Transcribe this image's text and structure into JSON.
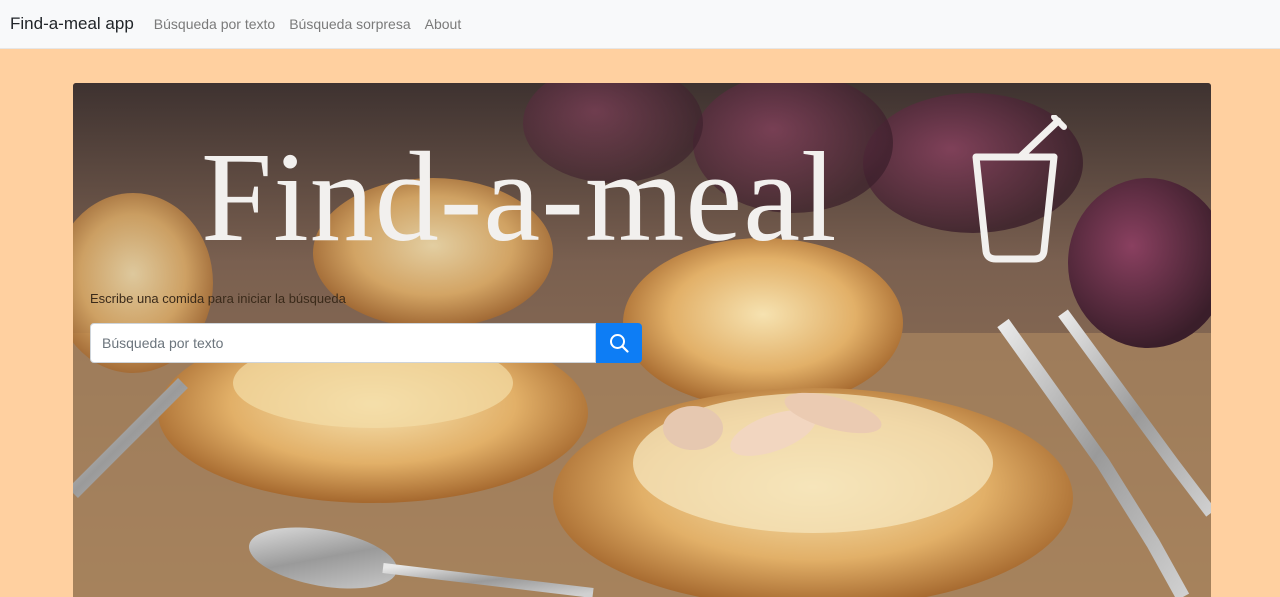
{
  "navbar": {
    "brand": "Find-a-meal app",
    "links": [
      {
        "label": "Búsqueda por texto"
      },
      {
        "label": "Búsqueda sorpresa"
      },
      {
        "label": "About"
      }
    ]
  },
  "hero": {
    "title": "Find-a-meal",
    "title_icon": "cup-with-straw-icon",
    "prompt": "Escribe una comida para iniciar la búsqueda",
    "search": {
      "placeholder": "Búsqueda por texto",
      "value": "",
      "button_icon": "search-icon"
    },
    "background_image": "pastries-with-almonds-photo"
  },
  "colors": {
    "page_background": "#FFD0A0",
    "navbar_background": "#F8F9FA",
    "search_button": "#0D7DF5",
    "title_text": "#F2F0EE"
  }
}
